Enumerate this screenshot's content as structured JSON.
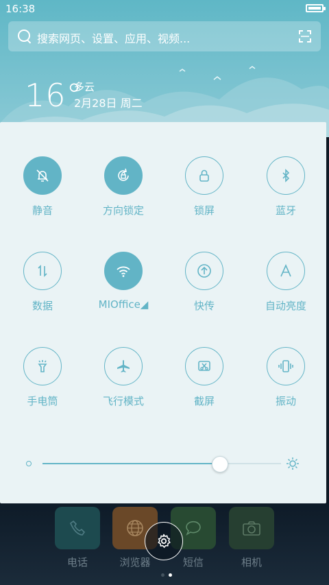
{
  "status_bar": {
    "time": "16:38"
  },
  "search": {
    "placeholder": "搜索网页、设置、应用、视频..."
  },
  "weather": {
    "temperature": "16°",
    "condition": "多云",
    "date": "2月28日 周二"
  },
  "toggles": [
    {
      "label": "静音",
      "on": true
    },
    {
      "label": "方向锁定",
      "on": true
    },
    {
      "label": "锁屏",
      "on": false
    },
    {
      "label": "蓝牙",
      "on": false
    },
    {
      "label": "数据",
      "on": false
    },
    {
      "label": "MIOffice◢",
      "on": true
    },
    {
      "label": "快传",
      "on": false
    },
    {
      "label": "自动亮度",
      "on": false
    },
    {
      "label": "手电筒",
      "on": false
    },
    {
      "label": "飞行模式",
      "on": false
    },
    {
      "label": "截屏",
      "on": false
    },
    {
      "label": "振动",
      "on": false
    }
  ],
  "brightness": {
    "level": 0.74
  },
  "dock": {
    "apps": [
      {
        "label": "电话",
        "color": "#1d5a5f"
      },
      {
        "label": "浏览器",
        "color": "#8a5a2a"
      },
      {
        "label": "短信",
        "color": "#2f5a3a"
      },
      {
        "label": "相机",
        "color": "#2d4a3a"
      }
    ]
  },
  "colors": {
    "accent": "#62b4c6",
    "panel_bg": "#eaf3f5"
  }
}
